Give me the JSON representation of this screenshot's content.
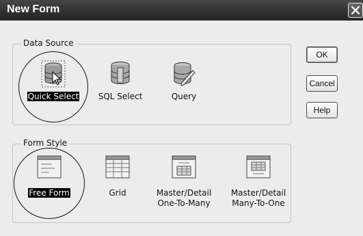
{
  "window": {
    "title": "New Form"
  },
  "data_source": {
    "label": "Data Source",
    "items": [
      {
        "label": "Quick Select",
        "icon": "database-cursor-icon",
        "selected": true
      },
      {
        "label": "SQL Select",
        "icon": "database-icon",
        "selected": false
      },
      {
        "label": "Query",
        "icon": "database-pencil-icon",
        "selected": false
      }
    ]
  },
  "form_style": {
    "label": "Form Style",
    "items": [
      {
        "label": "Free Form",
        "label2": "",
        "icon": "freeform-icon",
        "selected": true
      },
      {
        "label": "Grid",
        "label2": "",
        "icon": "grid-icon",
        "selected": false
      },
      {
        "label": "Master/Detail",
        "label2": "One-To-Many",
        "icon": "master-detail-one-to-many-icon",
        "selected": false
      },
      {
        "label": "Master/Detail",
        "label2": "Many-To-One",
        "icon": "master-detail-many-to-one-icon",
        "selected": false
      }
    ]
  },
  "buttons": {
    "ok": "OK",
    "cancel": "Cancel",
    "help": "Help"
  }
}
